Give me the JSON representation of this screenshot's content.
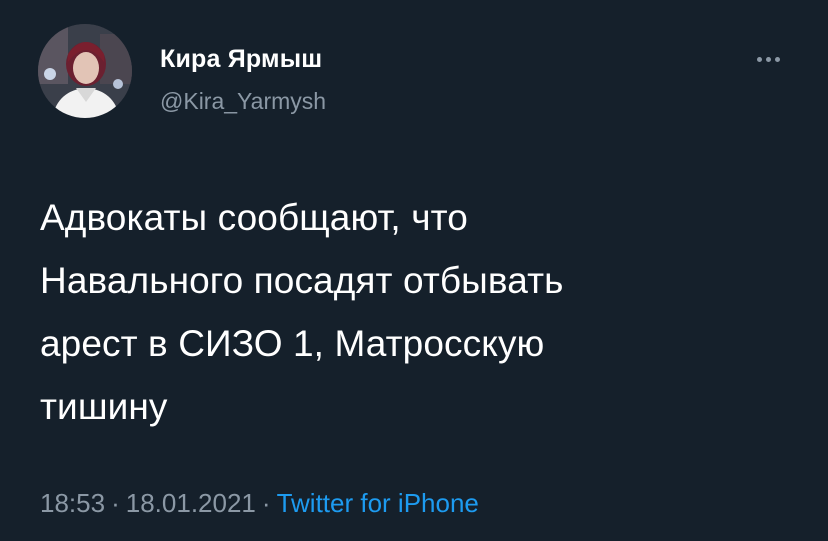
{
  "author": {
    "display_name": "Кира Ярмыш",
    "handle": "@Kira_Yarmysh"
  },
  "more_icon": "more-horizontal-icon",
  "tweet": {
    "lines": [
      "Адвокаты сообщают, что",
      "Навального посадят отбывать",
      "арест в СИЗО 1, Матросскую",
      "тишину"
    ]
  },
  "meta": {
    "time": "18:53",
    "separator": "·",
    "date": "18.01.2021",
    "source": "Twitter for iPhone"
  },
  "colors": {
    "background": "#15202b",
    "text": "#ffffff",
    "secondary": "#8b98a5",
    "link": "#1d9bf0"
  }
}
